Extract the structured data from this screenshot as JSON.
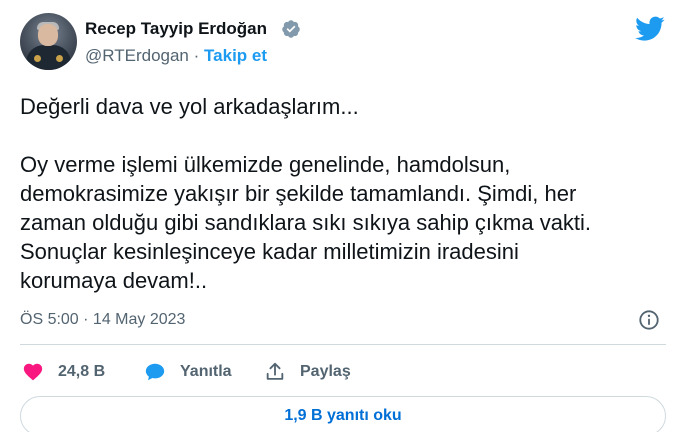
{
  "author": {
    "name": "Recep Tayyip Erdoğan",
    "handle": "@RTErdogan",
    "separator": "·",
    "follow_label": "Takip et"
  },
  "tweet": {
    "text": "Değerli dava ve yol arkadaşlarım...\n\nOy verme işlemi ülkemizde genelinde, hamdolsun,\ndemokrasimize yakışır bir şekilde tamamlandı. Şimdi, her\nzaman olduğu gibi sandıklara sıkı sıkıya sahip çıkma vakti.\nSonuçlar kesinleşinceye kadar milletimizin iradesini\nkorumaya devam!..",
    "timestamp": "ÖS 5:00 · 14 May 2023"
  },
  "actions": {
    "like_count": "24,8 B",
    "reply_label": "Yanıtla",
    "share_label": "Paylaş"
  },
  "replies_button": "1,9 B yanıtı oku",
  "icons": {
    "verified": "verified-badge-icon",
    "logo": "twitter-bird-icon",
    "info": "info-icon",
    "like": "heart-icon",
    "reply": "speech-bubble-icon",
    "share": "share-upload-icon"
  },
  "colors": {
    "accent": "#1d9bf0",
    "like": "#f91880",
    "link": "#006fd6",
    "secondary_text": "#536471"
  }
}
